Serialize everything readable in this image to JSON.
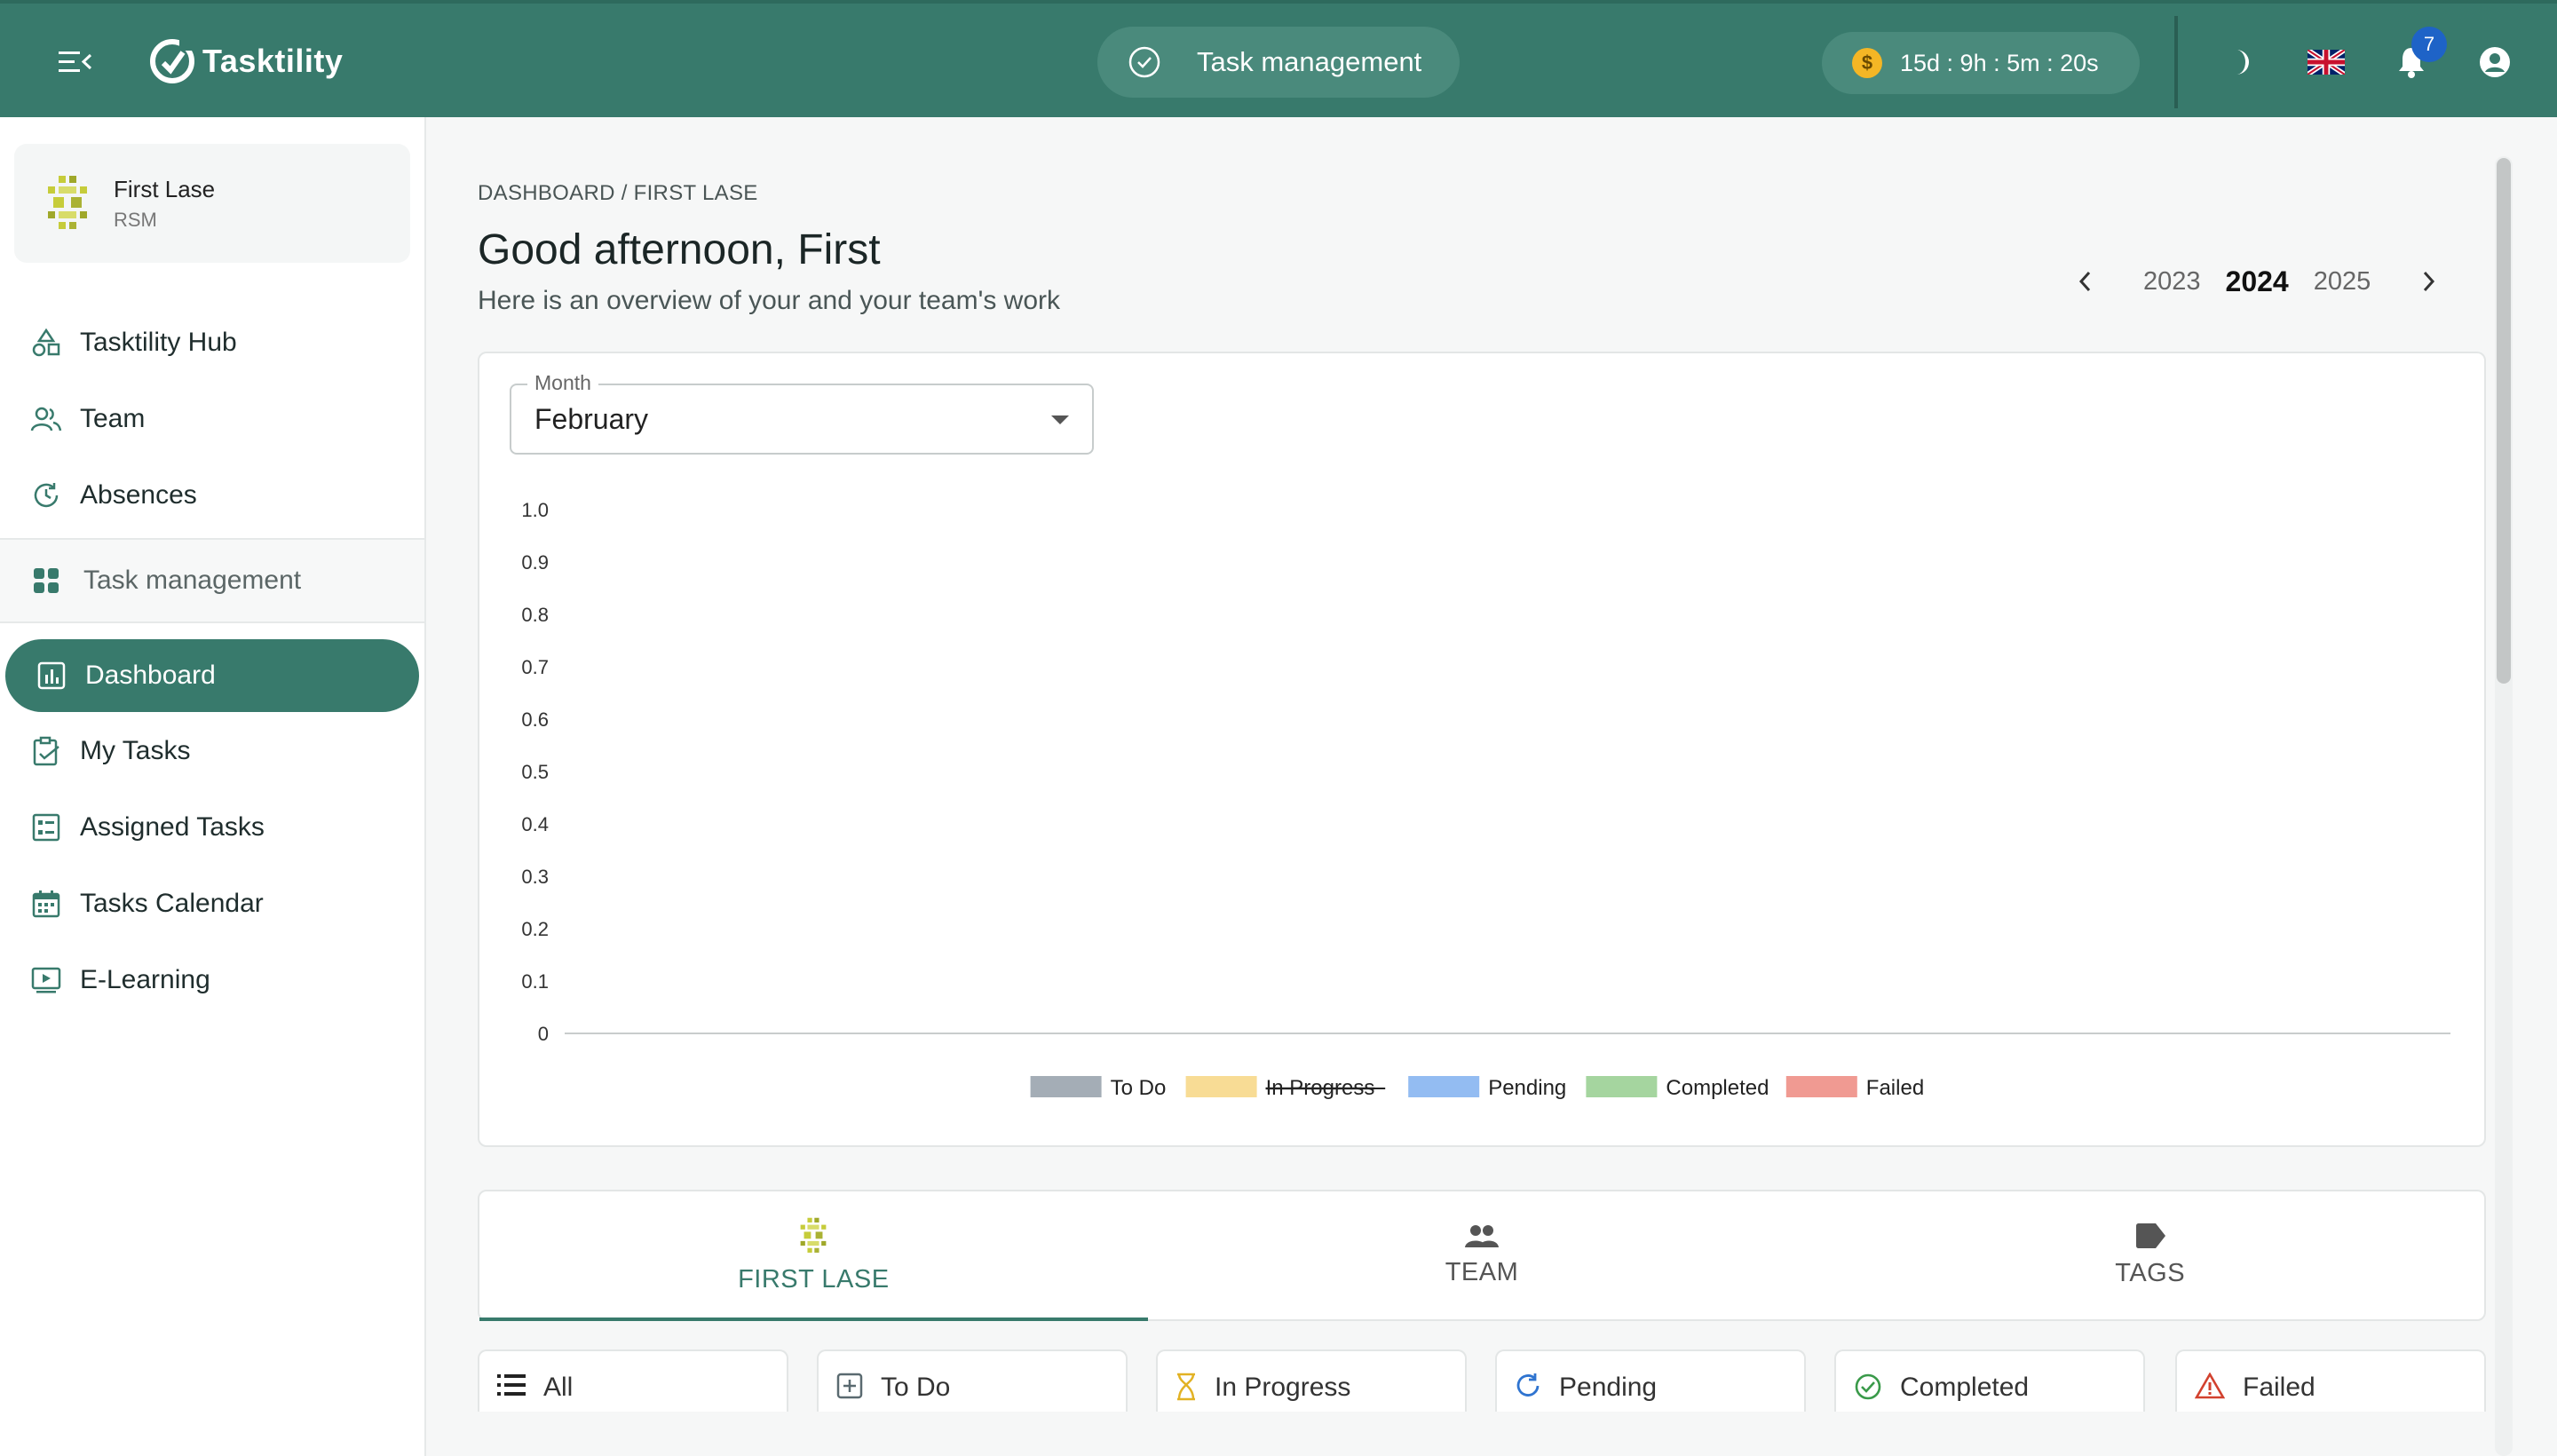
{
  "app": {
    "name": "Tasktility"
  },
  "header": {
    "module_label": "Task management",
    "timer": "15d : 9h : 5m : 20s",
    "notifications_count": "7"
  },
  "profile": {
    "name": "First Lase",
    "role": "RSM"
  },
  "sidebar": {
    "items": [
      {
        "label": "Tasktility Hub",
        "icon": "shapes-icon"
      },
      {
        "label": "Team",
        "icon": "people-icon"
      },
      {
        "label": "Absences",
        "icon": "history-icon"
      }
    ],
    "section": {
      "label": "Task management",
      "icon": "grid-icon"
    },
    "active": {
      "label": "Dashboard",
      "icon": "bar-chart-icon"
    },
    "sub_items": [
      {
        "label": "My Tasks",
        "icon": "clipboard-check-icon"
      },
      {
        "label": "Assigned Tasks",
        "icon": "list-board-icon"
      },
      {
        "label": "Tasks Calendar",
        "icon": "calendar-icon"
      },
      {
        "label": "E-Learning",
        "icon": "play-screen-icon"
      }
    ]
  },
  "page": {
    "breadcrumb": "DASHBOARD / FIRST LASE",
    "greeting": "Good afternoon, First",
    "subtitle": "Here is an overview of your and your team's work"
  },
  "years": {
    "options": [
      "2023",
      "2024",
      "2025"
    ],
    "selected": "2024"
  },
  "month_filter": {
    "label": "Month",
    "value": "February"
  },
  "chart_data": {
    "type": "bar",
    "categories": [],
    "series": [
      {
        "name": "To Do",
        "values": [],
        "color": "#a4adb6"
      },
      {
        "name": "In Progress",
        "values": [],
        "color": "#f8dc95",
        "hidden": true
      },
      {
        "name": "Pending",
        "values": [],
        "color": "#93bcf2"
      },
      {
        "name": "Completed",
        "values": [],
        "color": "#a5d59f"
      },
      {
        "name": "Failed",
        "values": [],
        "color": "#f09a92"
      }
    ],
    "yticks": [
      "1.0",
      "0.9",
      "0.8",
      "0.7",
      "0.6",
      "0.5",
      "0.4",
      "0.3",
      "0.2",
      "0.1",
      "0"
    ],
    "ylim": [
      0,
      1
    ],
    "grid": false,
    "legend": "bottom"
  },
  "tabs": [
    {
      "label": "FIRST LASE",
      "icon": "avatar-icon"
    },
    {
      "label": "TEAM",
      "icon": "group-icon"
    },
    {
      "label": "TAGS",
      "icon": "tag-icon"
    }
  ],
  "filters": [
    {
      "label": "All",
      "icon": "list-icon",
      "color": "#222222"
    },
    {
      "label": "To Do",
      "icon": "plus-box-icon",
      "color": "#5a6a70"
    },
    {
      "label": "In Progress",
      "icon": "hourglass-icon",
      "color": "#e2b224"
    },
    {
      "label": "Pending",
      "icon": "refresh-icon",
      "color": "#2f74d0"
    },
    {
      "label": "Completed",
      "icon": "check-circle-icon",
      "color": "#3a9a4a"
    },
    {
      "label": "Failed",
      "icon": "warning-icon",
      "color": "#d2412e"
    }
  ]
}
